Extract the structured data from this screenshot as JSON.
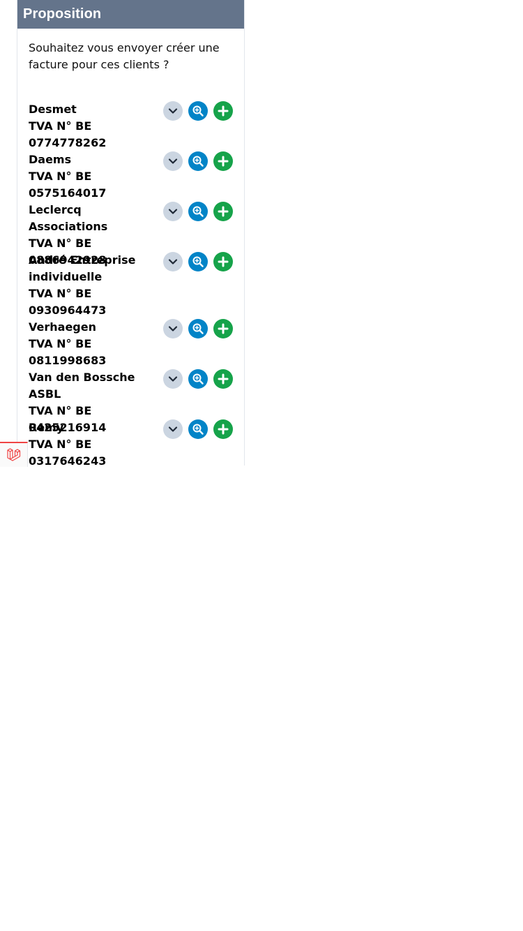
{
  "panel": {
    "title": "Proposition",
    "intro": "Souhaitez vous envoyer créer une facture pour ces clients ?"
  },
  "clients": [
    {
      "name": "Desmet",
      "vat": "TVA N° BE 0774778262"
    },
    {
      "name": "Daems",
      "vat": "TVA N° BE 0575164017"
    },
    {
      "name": "Leclercq Associations",
      "vat": "TVA N° BE 0886942928"
    },
    {
      "name": "André Entreprise individuelle",
      "vat": "TVA N° BE 0930964473"
    },
    {
      "name": "Verhaegen",
      "vat": "TVA N° BE 0811998683"
    },
    {
      "name": "Van den Bossche ASBL",
      "vat": "TVA N° BE 0425216914"
    },
    {
      "name": "Remy",
      "vat": "TVA N° BE 0317646243"
    }
  ],
  "icons": {
    "expand": "chevron-down-icon",
    "view": "zoom-in-icon",
    "add": "plus-icon",
    "debug": "laravel-logo-icon"
  },
  "colors": {
    "header": "#64748b",
    "expand_button": "#cbd5e1",
    "view_button": "#0284c7",
    "add_button": "#16a34a",
    "debug_accent": "#ef4444"
  }
}
